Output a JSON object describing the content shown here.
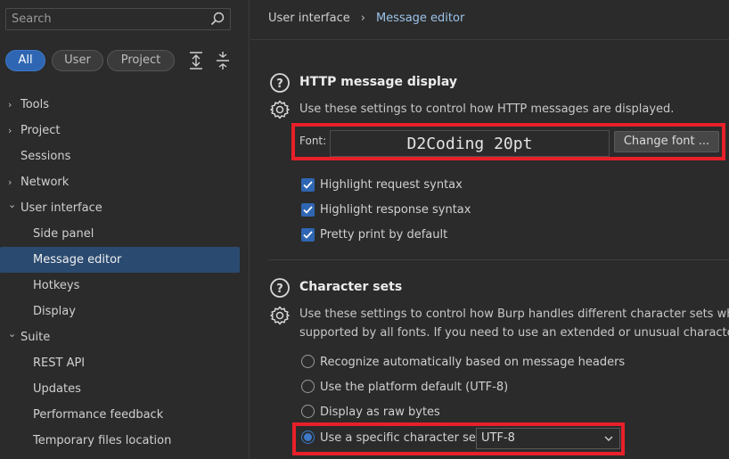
{
  "search": {
    "placeholder": "Search"
  },
  "filters": {
    "all": "All",
    "user": "User",
    "project": "Project"
  },
  "tree": [
    {
      "label": "Tools",
      "chevron": "›"
    },
    {
      "label": "Project",
      "chevron": "›"
    },
    {
      "label": "Sessions",
      "chevron": ""
    },
    {
      "label": "Network",
      "chevron": "›"
    },
    {
      "label": "User interface",
      "chevron": "⌄"
    },
    {
      "label": "Side panel",
      "chevron": ""
    },
    {
      "label": "Message editor",
      "chevron": ""
    },
    {
      "label": "Hotkeys",
      "chevron": ""
    },
    {
      "label": "Display",
      "chevron": ""
    },
    {
      "label": "Suite",
      "chevron": "⌄"
    },
    {
      "label": "REST API",
      "chevron": ""
    },
    {
      "label": "Updates",
      "chevron": ""
    },
    {
      "label": "Performance feedback",
      "chevron": ""
    },
    {
      "label": "Temporary files location",
      "chevron": ""
    }
  ],
  "breadcrumb": {
    "parent": "User interface",
    "separator": "›",
    "current": "Message editor"
  },
  "http_display": {
    "title": "HTTP message display",
    "description": "Use these settings to control how HTTP messages are displayed.",
    "font_label": "Font:",
    "font_value": "D2Coding 20pt",
    "change_font": "Change font ...",
    "checks": [
      {
        "label": "Highlight request syntax",
        "checked": true
      },
      {
        "label": "Highlight response syntax",
        "checked": true
      },
      {
        "label": "Pretty print by default",
        "checked": true
      }
    ]
  },
  "charsets": {
    "title": "Character sets",
    "description_line1": "Use these settings to control how Burp handles different character sets when d",
    "description_line2": "supported by all fonts. If you need to use an extended or unusual character se",
    "options": [
      {
        "label": "Recognize automatically based on message headers",
        "selected": false
      },
      {
        "label": "Use the platform default (UTF-8)",
        "selected": false
      },
      {
        "label": "Display as raw bytes",
        "selected": false
      },
      {
        "label": "Use a specific character set:",
        "selected": true
      }
    ],
    "selected_charset": "UTF-8"
  },
  "colors": {
    "accent": "#2f66b3",
    "selection": "#2a4a70",
    "highlight_box": "#e8202a",
    "link": "#9cc3ea"
  }
}
